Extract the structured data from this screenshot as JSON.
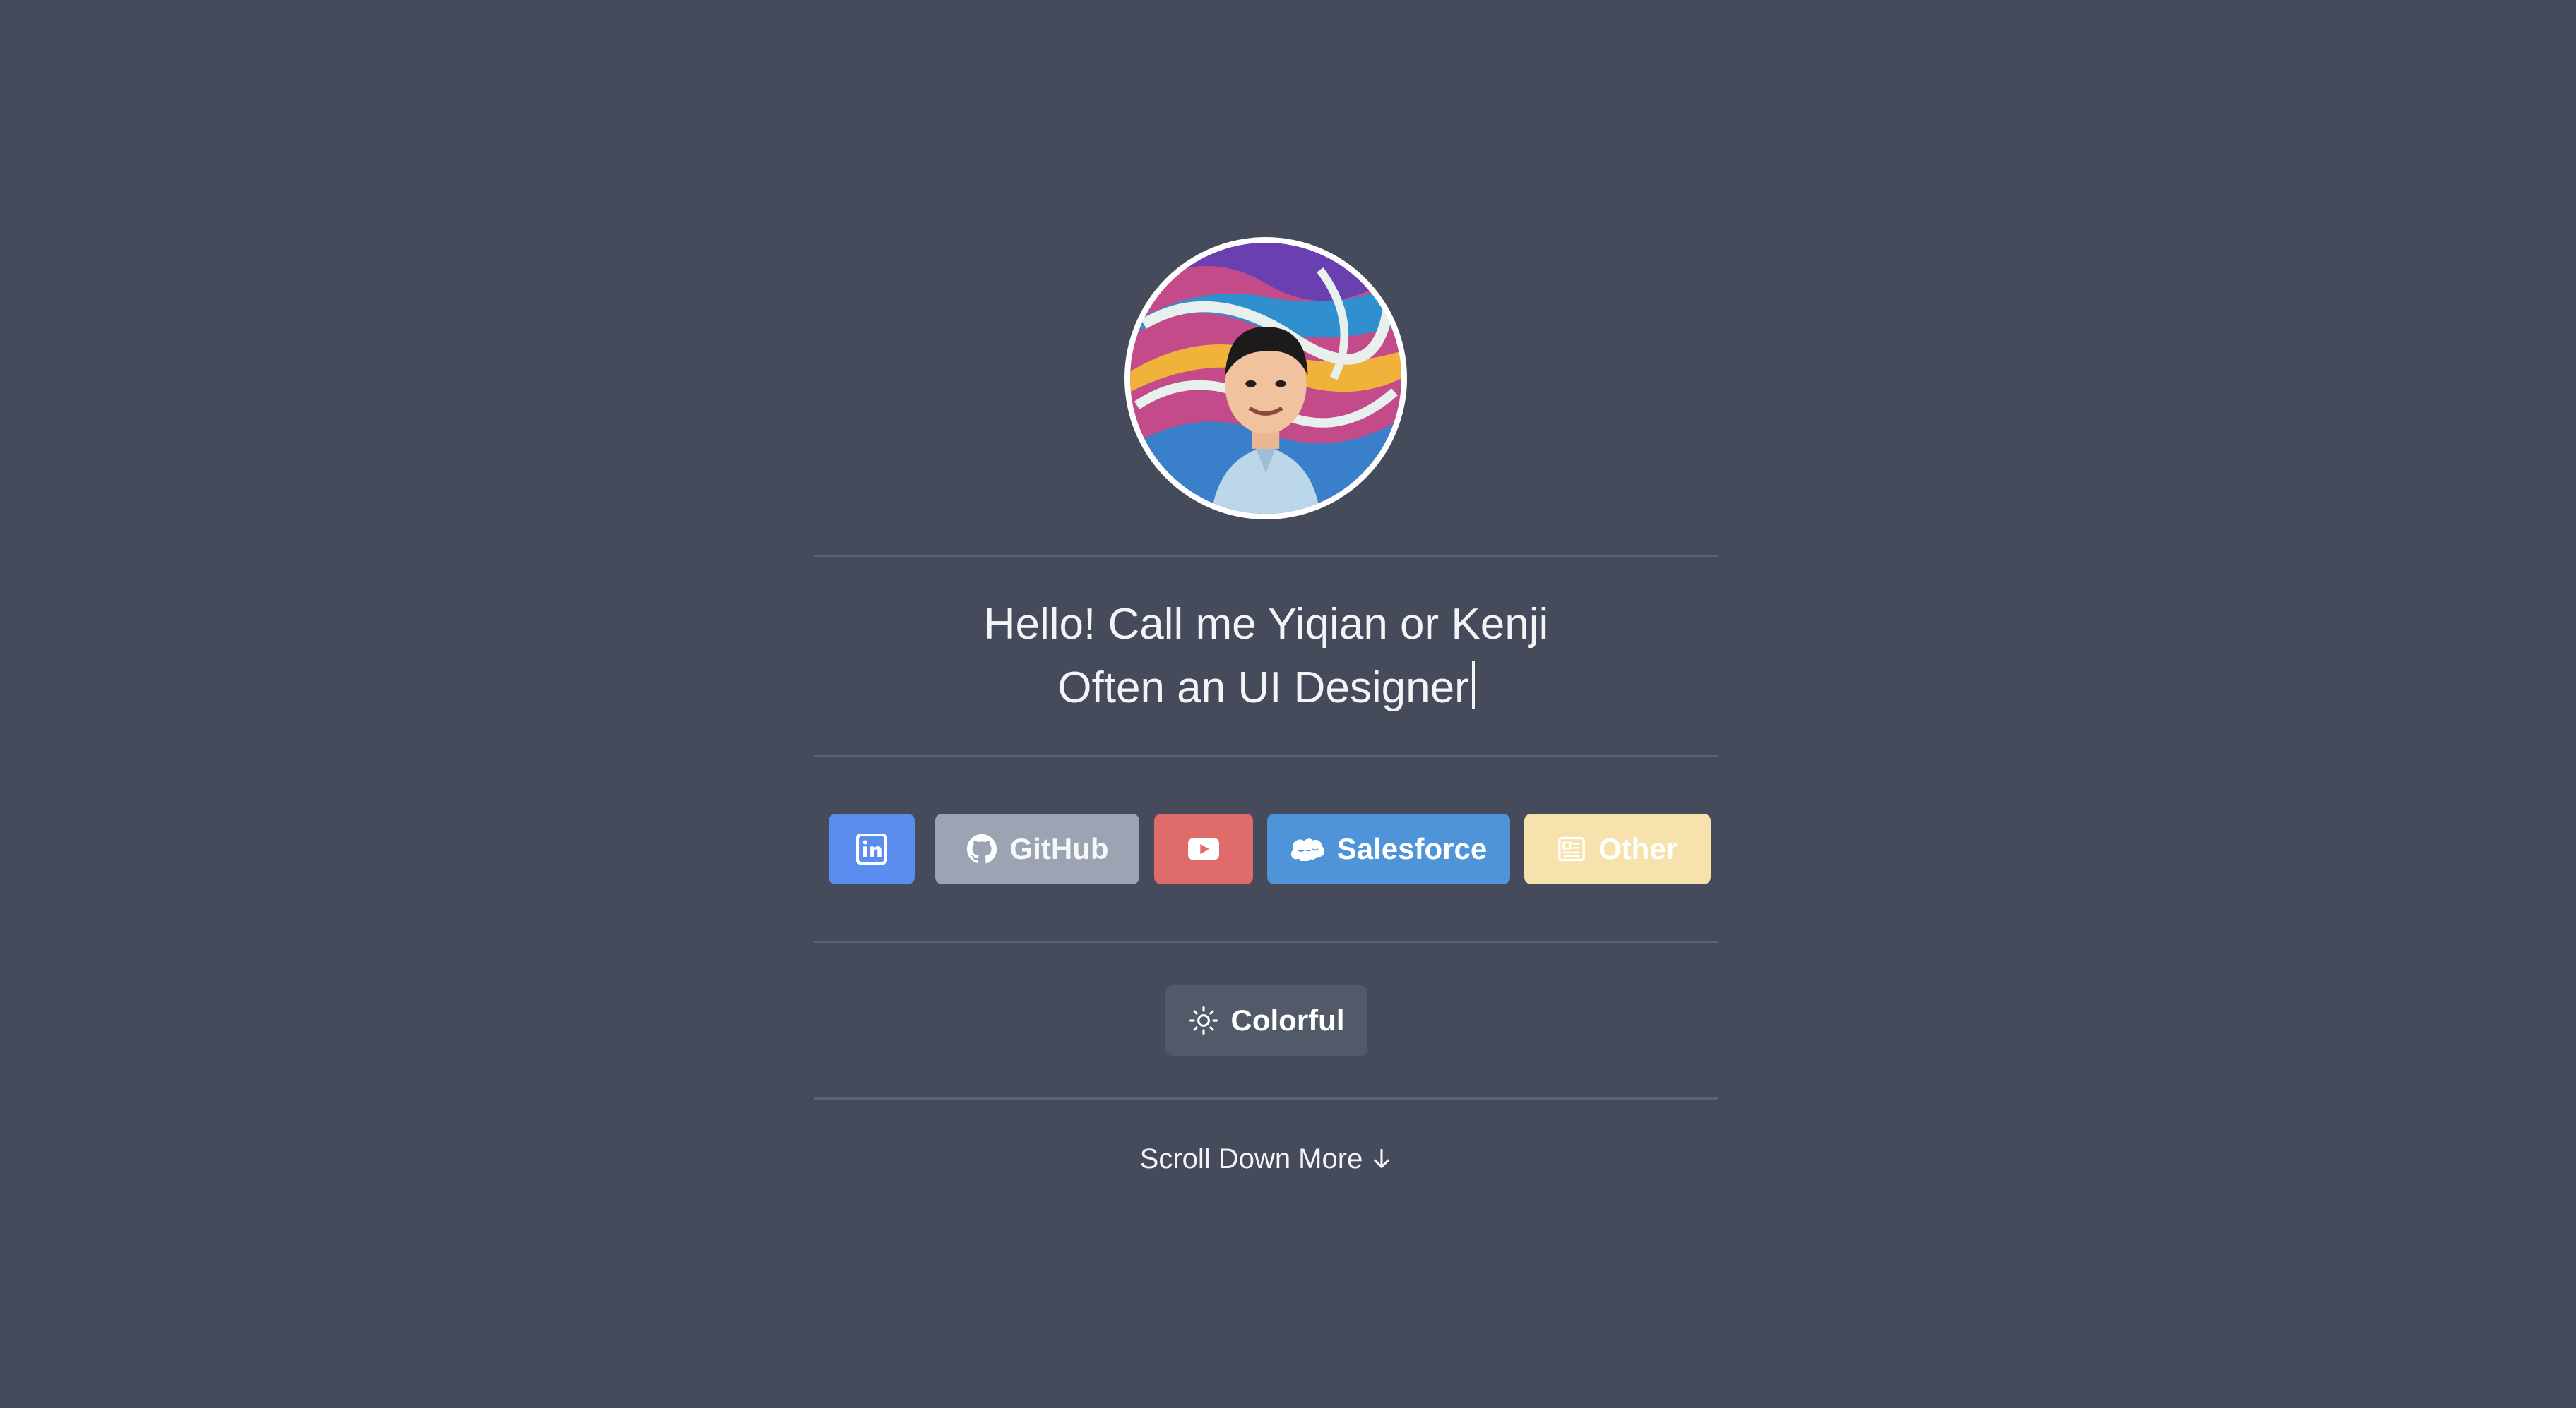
{
  "colors": {
    "background": "#454b5b",
    "divider": "#5d6373",
    "linkedin": "#5b8def",
    "github": "#9ca3b2",
    "youtube": "#e06b6b",
    "salesforce": "#4f93d8",
    "other": "#f7e2ad",
    "colorful": "#525a6a"
  },
  "profile": {
    "avatar_icon": "profile-photo"
  },
  "greeting": {
    "line1": "Hello! Call me Yiqian or Kenji",
    "line2": "Often an UI Designer"
  },
  "links": {
    "linkedin": {
      "icon": "linkedin-icon"
    },
    "github": {
      "label": "GitHub",
      "icon": "github-icon"
    },
    "youtube": {
      "icon": "youtube-icon"
    },
    "salesforce": {
      "label": "Salesforce",
      "icon": "salesforce-cloud-icon"
    },
    "other": {
      "label": "Other",
      "icon": "newspaper-icon"
    }
  },
  "theme_toggle": {
    "label": "Colorful",
    "icon": "sun-icon"
  },
  "scroll_hint": {
    "label": "Scroll Down More",
    "icon": "arrow-down-icon"
  }
}
